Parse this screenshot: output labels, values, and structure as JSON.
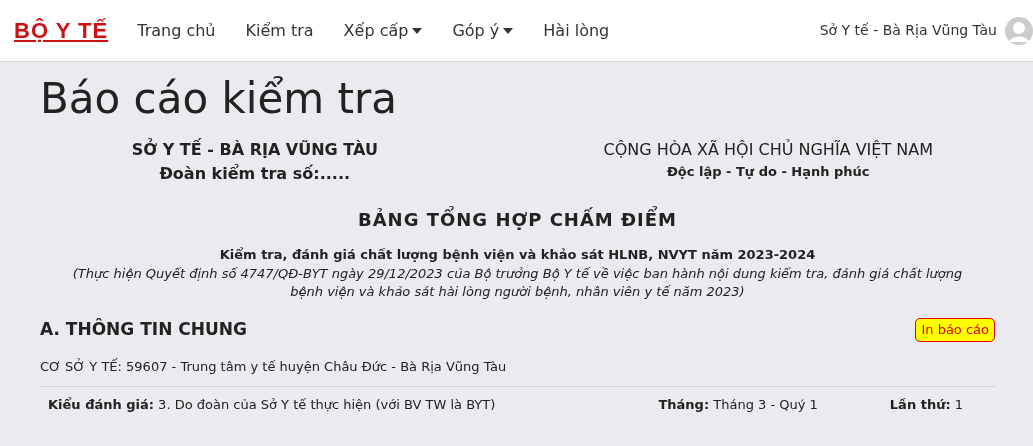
{
  "navbar": {
    "brand": "BỘ Y TẾ",
    "items": [
      {
        "label": "Trang chủ",
        "kind": "link"
      },
      {
        "label": "Kiểm tra",
        "kind": "link"
      },
      {
        "label": "Xếp cấp",
        "kind": "dropdown"
      },
      {
        "label": "Góp ý",
        "kind": "dropdown"
      },
      {
        "label": "Hài lòng",
        "kind": "link"
      }
    ],
    "user": "Sở Y tế - Bà Rịa Vũng Tàu"
  },
  "page_title": "Báo cáo kiểm tra",
  "header": {
    "left": [
      "SỞ Y TẾ - BÀ RỊA VŨNG TÀU",
      "Đoàn kiểm tra số:....."
    ],
    "right": [
      "CỘNG HÒA XÃ HỘI CHỦ NGHĨA VIỆT NAM",
      "Độc lập - Tự do - Hạnh phúc"
    ]
  },
  "report": {
    "title": "BẢNG TỔNG HỢP CHẤM ĐIỂM",
    "subtitle": "Kiểm tra, đánh giá chất lượng bệnh viện và khảo sát HLNB, NVYT năm 2023-2024",
    "note": "(Thực hiện Quyết định số 4747/QĐ-BYT ngày 29/12/2023 của Bộ trưởng Bộ Y tế về việc ban hành nội dung kiểm tra, đánh giá chất lượng bệnh viện và khảo sát hài lòng người bệnh, nhân viên y tế năm 2023)"
  },
  "section": {
    "heading": "A. THÔNG TIN CHUNG",
    "print_button": "In báo cáo",
    "facility": "CƠ SỞ Y TẾ: 59607 - Trung tâm y tế huyện Châu Đức - Bà Rịa Vũng Tàu",
    "fields": [
      "**Kiểu đánh giá:** 3. Do đoàn của Sở Y tế thực hiện (với BV TW là BYT)",
      "**Tháng:** Tháng 3 - Quý 1",
      "**Lần thứ:** 1"
    ]
  }
}
